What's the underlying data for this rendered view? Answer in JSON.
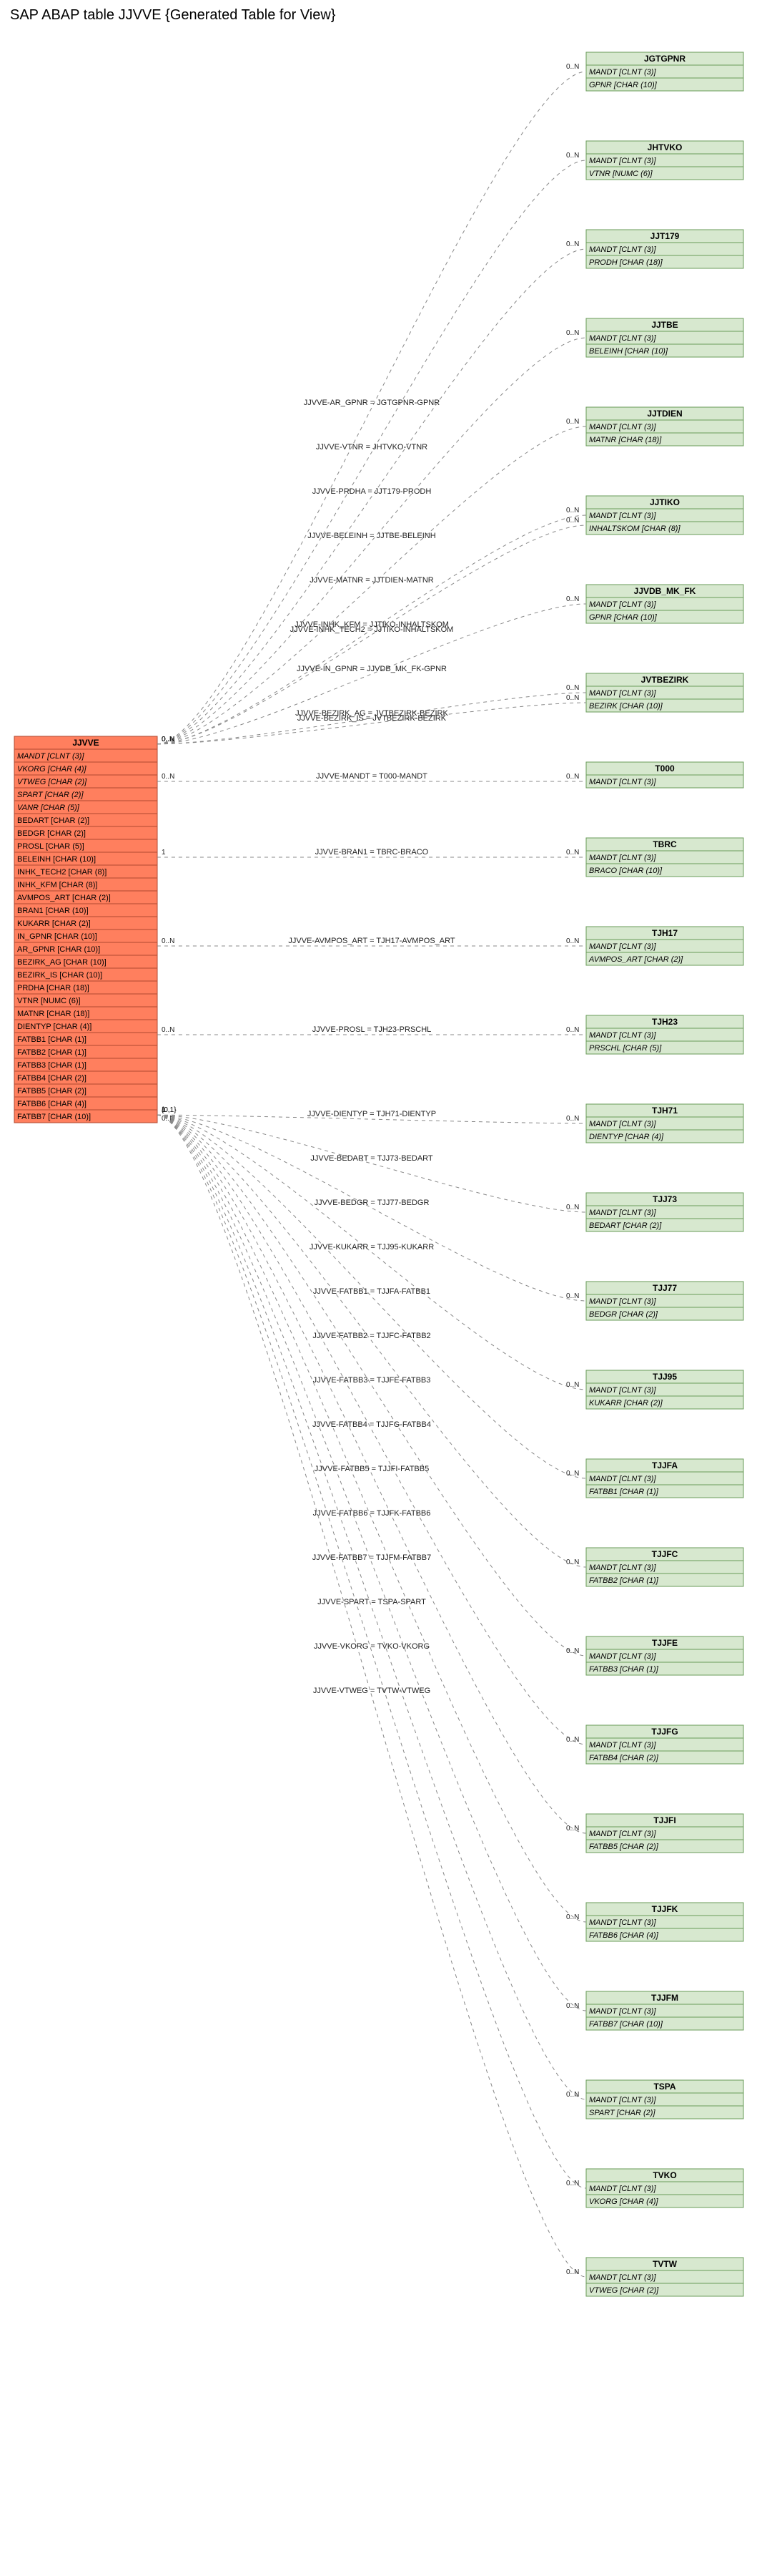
{
  "title": "SAP ABAP table JJVVE {Generated Table for View}",
  "main_table": {
    "name": "JJVVE",
    "fields": [
      {
        "name": "MANDT",
        "type": "CLNT",
        "len": "3",
        "italic": true
      },
      {
        "name": "VKORG",
        "type": "CHAR",
        "len": "4",
        "italic": true
      },
      {
        "name": "VTWEG",
        "type": "CHAR",
        "len": "2",
        "italic": true
      },
      {
        "name": "SPART",
        "type": "CHAR",
        "len": "2",
        "italic": true
      },
      {
        "name": "VANR",
        "type": "CHAR",
        "len": "5",
        "italic": true
      },
      {
        "name": "BEDART",
        "type": "CHAR",
        "len": "2",
        "italic": false
      },
      {
        "name": "BEDGR",
        "type": "CHAR",
        "len": "2",
        "italic": false
      },
      {
        "name": "PROSL",
        "type": "CHAR",
        "len": "5",
        "italic": false
      },
      {
        "name": "BELEINH",
        "type": "CHAR",
        "len": "10",
        "italic": false
      },
      {
        "name": "INHK_TECH2",
        "type": "CHAR",
        "len": "8",
        "italic": false
      },
      {
        "name": "INHK_KFM",
        "type": "CHAR",
        "len": "8",
        "italic": false
      },
      {
        "name": "AVMPOS_ART",
        "type": "CHAR",
        "len": "2",
        "italic": false
      },
      {
        "name": "BRAN1",
        "type": "CHAR",
        "len": "10",
        "italic": false
      },
      {
        "name": "KUKARR",
        "type": "CHAR",
        "len": "2",
        "italic": false
      },
      {
        "name": "IN_GPNR",
        "type": "CHAR",
        "len": "10",
        "italic": false
      },
      {
        "name": "AR_GPNR",
        "type": "CHAR",
        "len": "10",
        "italic": false
      },
      {
        "name": "BEZIRK_AG",
        "type": "CHAR",
        "len": "10",
        "italic": false
      },
      {
        "name": "BEZIRK_IS",
        "type": "CHAR",
        "len": "10",
        "italic": false
      },
      {
        "name": "PRDHA",
        "type": "CHAR",
        "len": "18",
        "italic": false
      },
      {
        "name": "VTNR",
        "type": "NUMC",
        "len": "6",
        "italic": false
      },
      {
        "name": "MATNR",
        "type": "CHAR",
        "len": "18",
        "italic": false
      },
      {
        "name": "DIENTYP",
        "type": "CHAR",
        "len": "4",
        "italic": false
      },
      {
        "name": "FATBB1",
        "type": "CHAR",
        "len": "1",
        "italic": false
      },
      {
        "name": "FATBB2",
        "type": "CHAR",
        "len": "1",
        "italic": false
      },
      {
        "name": "FATBB3",
        "type": "CHAR",
        "len": "1",
        "italic": false
      },
      {
        "name": "FATBB4",
        "type": "CHAR",
        "len": "2",
        "italic": false
      },
      {
        "name": "FATBB5",
        "type": "CHAR",
        "len": "2",
        "italic": false
      },
      {
        "name": "FATBB6",
        "type": "CHAR",
        "len": "4",
        "italic": false
      },
      {
        "name": "FATBB7",
        "type": "CHAR",
        "len": "10",
        "italic": false
      }
    ]
  },
  "targets": [
    {
      "name": "JGTGPNR",
      "fields": [
        {
          "name": "MANDT",
          "type": "CLNT",
          "len": "3",
          "italic": true
        },
        {
          "name": "GPNR",
          "type": "CHAR",
          "len": "10",
          "italic": true
        }
      ],
      "edge": "JJVVE-AR_GPNR = JGTGPNR-GPNR",
      "src_card": "0..N",
      "dst_card": "0..N"
    },
    {
      "name": "JHTVKO",
      "fields": [
        {
          "name": "MANDT",
          "type": "CLNT",
          "len": "3",
          "italic": true
        },
        {
          "name": "VTNR",
          "type": "NUMC",
          "len": "6",
          "italic": true
        }
      ],
      "edge": "JJVVE-VTNR = JHTVKO-VTNR",
      "src_card": "0..N",
      "dst_card": "0..N"
    },
    {
      "name": "JJT179",
      "fields": [
        {
          "name": "MANDT",
          "type": "CLNT",
          "len": "3",
          "italic": true
        },
        {
          "name": "PRODH",
          "type": "CHAR",
          "len": "18",
          "italic": true
        }
      ],
      "edge": "JJVVE-PRDHA = JJT179-PRODH",
      "src_card": "0..N",
      "dst_card": "0..N"
    },
    {
      "name": "JJTBE",
      "fields": [
        {
          "name": "MANDT",
          "type": "CLNT",
          "len": "3",
          "italic": true
        },
        {
          "name": "BELEINH",
          "type": "CHAR",
          "len": "10",
          "italic": true
        }
      ],
      "edge": "JJVVE-BELEINH = JJTBE-BELEINH",
      "src_card": "0..N",
      "dst_card": "0..N"
    },
    {
      "name": "JJTDIEN",
      "fields": [
        {
          "name": "MANDT",
          "type": "CLNT",
          "len": "3",
          "italic": true
        },
        {
          "name": "MATNR",
          "type": "CHAR",
          "len": "18",
          "italic": true
        }
      ],
      "edge": "JJVVE-MATNR = JJTDIEN-MATNR",
      "src_card": "0..N",
      "dst_card": "0..N"
    },
    {
      "name": "JJTIKO",
      "fields": [
        {
          "name": "MANDT",
          "type": "CLNT",
          "len": "3",
          "italic": true
        },
        {
          "name": "INHALTSKOM",
          "type": "CHAR",
          "len": "8",
          "italic": true
        }
      ],
      "edge": "JJVVE-INHK_KFM = JJTIKO-INHALTSKOM",
      "src_card": "0..N",
      "dst_card": "0..N",
      "edge2": "JJVVE-INHK_TECH2 = JJTIKO-INHALTSKOM",
      "src_card2": "0..N",
      "dst_card2": "0..N"
    },
    {
      "name": "JJVDB_MK_FK",
      "fields": [
        {
          "name": "MANDT",
          "type": "CLNT",
          "len": "3",
          "italic": true
        },
        {
          "name": "GPNR",
          "type": "CHAR",
          "len": "10",
          "italic": true
        }
      ],
      "edge": "JJVVE-IN_GPNR = JJVDB_MK_FK-GPNR",
      "src_card": "0..N",
      "dst_card": "0..N"
    },
    {
      "name": "JVTBEZIRK",
      "fields": [
        {
          "name": "MANDT",
          "type": "CLNT",
          "len": "3",
          "italic": true
        },
        {
          "name": "BEZIRK",
          "type": "CHAR",
          "len": "10",
          "italic": true
        }
      ],
      "edge": "JJVVE-BEZIRK_AG = JVTBEZIRK-BEZIRK",
      "src_card": "0..N",
      "dst_card": "0..N",
      "edge2": "JJVVE-BEZIRK_IS = JVTBEZIRK-BEZIRK",
      "src_card2": "0..N",
      "dst_card2": "0..N"
    },
    {
      "name": "T000",
      "fields": [
        {
          "name": "MANDT",
          "type": "CLNT",
          "len": "3",
          "italic": true
        }
      ],
      "edge": "JJVVE-MANDT = T000-MANDT",
      "src_card": "0..N",
      "dst_card": "0..N",
      "single_row": true
    },
    {
      "name": "TBRC",
      "fields": [
        {
          "name": "MANDT",
          "type": "CLNT",
          "len": "3",
          "italic": true
        },
        {
          "name": "BRACO",
          "type": "CHAR",
          "len": "10",
          "italic": true
        }
      ],
      "edge": "JJVVE-BRAN1 = TBRC-BRACO",
      "src_card": "1",
      "dst_card": "0..N"
    },
    {
      "name": "TJH17",
      "fields": [
        {
          "name": "MANDT",
          "type": "CLNT",
          "len": "3",
          "italic": true
        },
        {
          "name": "AVMPOS_ART",
          "type": "CHAR",
          "len": "2",
          "italic": true
        }
      ],
      "edge": "JJVVE-AVMPOS_ART = TJH17-AVMPOS_ART",
      "src_card": "0..N",
      "dst_card": "0..N"
    },
    {
      "name": "TJH23",
      "fields": [
        {
          "name": "MANDT",
          "type": "CLNT",
          "len": "3",
          "italic": true
        },
        {
          "name": "PRSCHL",
          "type": "CHAR",
          "len": "5",
          "italic": true
        }
      ],
      "edge": "JJVVE-PROSL = TJH23-PRSCHL",
      "src_card": "0..N",
      "dst_card": "0..N"
    },
    {
      "name": "TJH71",
      "fields": [
        {
          "name": "MANDT",
          "type": "CLNT",
          "len": "3",
          "italic": true
        },
        {
          "name": "DIENTYP",
          "type": "CHAR",
          "len": "4",
          "italic": true
        }
      ],
      "edge": "JJVVE-DIENTYP = TJH71-DIENTYP",
      "src_card": "1\n0..N",
      "dst_card": "0..N"
    },
    {
      "name": "TJJ73",
      "fields": [
        {
          "name": "MANDT",
          "type": "CLNT",
          "len": "3",
          "italic": true
        },
        {
          "name": "BEDART",
          "type": "CHAR",
          "len": "2",
          "italic": true
        }
      ],
      "edge": "JJVVE-BEDART = TJJ73-BEDART",
      "src_card": "{0,1}",
      "dst_card": "0..N"
    },
    {
      "name": "TJJ77",
      "fields": [
        {
          "name": "MANDT",
          "type": "CLNT",
          "len": "3",
          "italic": true
        },
        {
          "name": "BEDGR",
          "type": "CHAR",
          "len": "2",
          "italic": true
        }
      ],
      "edge": "JJVVE-BEDGR = TJJ77-BEDGR",
      "src_card": "1",
      "dst_card": "0..N"
    },
    {
      "name": "TJJ95",
      "fields": [
        {
          "name": "MANDT",
          "type": "CLNT",
          "len": "3",
          "italic": true
        },
        {
          "name": "KUKARR",
          "type": "CHAR",
          "len": "2",
          "italic": true
        }
      ],
      "edge": "JJVVE-KUKARR = TJJ95-KUKARR",
      "src_card": "{0,1}",
      "dst_card": "0..N"
    },
    {
      "name": "TJJFA",
      "fields": [
        {
          "name": "MANDT",
          "type": "CLNT",
          "len": "3",
          "italic": true
        },
        {
          "name": "FATBB1",
          "type": "CHAR",
          "len": "1",
          "italic": true
        }
      ],
      "edge": "JJVVE-FATBB1 = TJJFA-FATBB1",
      "src_card": "1",
      "dst_card": "0..N"
    },
    {
      "name": "TJJFC",
      "fields": [
        {
          "name": "MANDT",
          "type": "CLNT",
          "len": "3",
          "italic": true
        },
        {
          "name": "FATBB2",
          "type": "CHAR",
          "len": "1",
          "italic": true
        }
      ],
      "edge": "JJVVE-FATBB2 = TJJFC-FATBB2",
      "src_card": "1",
      "dst_card": "0..N"
    },
    {
      "name": "TJJFE",
      "fields": [
        {
          "name": "MANDT",
          "type": "CLNT",
          "len": "3",
          "italic": true
        },
        {
          "name": "FATBB3",
          "type": "CHAR",
          "len": "1",
          "italic": true
        }
      ],
      "edge": "JJVVE-FATBB3 = TJJFE-FATBB3",
      "src_card": "1",
      "dst_card": "0..N"
    },
    {
      "name": "TJJFG",
      "fields": [
        {
          "name": "MANDT",
          "type": "CLNT",
          "len": "3",
          "italic": true
        },
        {
          "name": "FATBB4",
          "type": "CHAR",
          "len": "2",
          "italic": true
        }
      ],
      "edge": "JJVVE-FATBB4 = TJJFG-FATBB4",
      "src_card": "1",
      "dst_card": "0..N"
    },
    {
      "name": "TJJFI",
      "fields": [
        {
          "name": "MANDT",
          "type": "CLNT",
          "len": "3",
          "italic": true
        },
        {
          "name": "FATBB5",
          "type": "CHAR",
          "len": "2",
          "italic": true
        }
      ],
      "edge": "JJVVE-FATBB5 = TJJFI-FATBB5",
      "src_card": "1",
      "dst_card": "0..N"
    },
    {
      "name": "TJJFK",
      "fields": [
        {
          "name": "MANDT",
          "type": "CLNT",
          "len": "3",
          "italic": true
        },
        {
          "name": "FATBB6",
          "type": "CHAR",
          "len": "4",
          "italic": true
        }
      ],
      "edge": "JJVVE-FATBB6 = TJJFK-FATBB6",
      "src_card": "1",
      "dst_card": "0..N"
    },
    {
      "name": "TJJFM",
      "fields": [
        {
          "name": "MANDT",
          "type": "CLNT",
          "len": "3",
          "italic": true
        },
        {
          "name": "FATBB7",
          "type": "CHAR",
          "len": "10",
          "italic": true
        }
      ],
      "edge": "JJVVE-FATBB7 = TJJFM-FATBB7",
      "src_card": "1",
      "dst_card": "0..N"
    },
    {
      "name": "TSPA",
      "fields": [
        {
          "name": "MANDT",
          "type": "CLNT",
          "len": "3",
          "italic": true
        },
        {
          "name": "SPART",
          "type": "CHAR",
          "len": "2",
          "italic": true
        }
      ],
      "edge": "JJVVE-SPART = TSPA-SPART",
      "src_card": "1",
      "dst_card": "0..N"
    },
    {
      "name": "TVKO",
      "fields": [
        {
          "name": "MANDT",
          "type": "CLNT",
          "len": "3",
          "italic": true
        },
        {
          "name": "VKORG",
          "type": "CHAR",
          "len": "4",
          "italic": true
        }
      ],
      "edge": "JJVVE-VKORG = TVKO-VKORG",
      "src_card": "1",
      "dst_card": "0..N"
    },
    {
      "name": "TVTW",
      "fields": [
        {
          "name": "MANDT",
          "type": "CLNT",
          "len": "3",
          "italic": true
        },
        {
          "name": "VTWEG",
          "type": "CHAR",
          "len": "2",
          "italic": true
        }
      ],
      "edge": "JJVVE-VTWEG = TVTW-VTWEG",
      "src_card": "1",
      "dst_card": "0..N"
    }
  ]
}
